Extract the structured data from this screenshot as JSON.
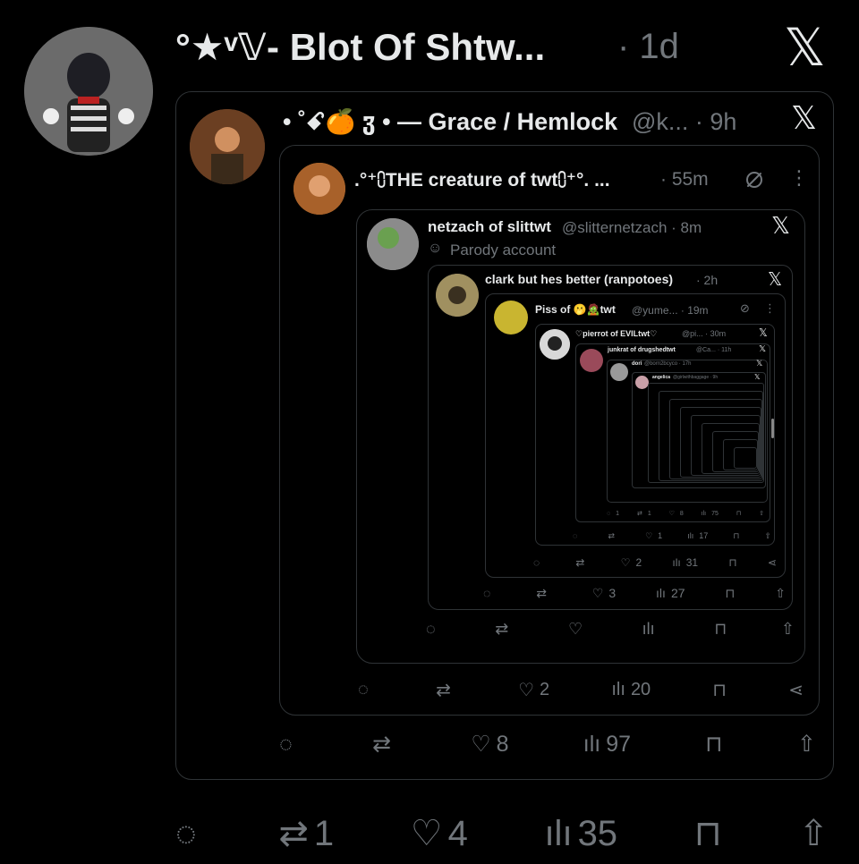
{
  "outer_post": {
    "author": "°★ᵛ𝕍- Blot Of Shtw...",
    "time": "· 1d",
    "actions": {
      "reply": "",
      "repost": "1",
      "like": "4",
      "views": "35"
    }
  },
  "quote1": {
    "author": "• ˚ꗃ🍊 ჳ • — Grace / Hemlock",
    "handle": "@k... · 9h",
    "actions": {
      "reply": "",
      "repost": "",
      "like": "8",
      "views": "97"
    }
  },
  "quote2": {
    "author": ".°⁺⩇THE creature of twt⩇⁺°. ...",
    "time": "· 55m",
    "actions": {
      "reply": "",
      "repost": "",
      "like": "2",
      "views": "20"
    }
  },
  "quote3": {
    "author": "netzach of slittwt",
    "handle": "@slitternetzach · 8m",
    "badge": "Parody account",
    "actions": {
      "reply": "",
      "repost": "",
      "like": "",
      "views": ""
    }
  },
  "quote4": {
    "author": "clark but hes better (ranpotoes)",
    "time": "· 2h",
    "actions": {
      "reply": "",
      "repost": "",
      "like": "3",
      "views": "27"
    }
  },
  "quote5": {
    "author": "Piss of 🫢🧟twt",
    "handle": "@yume... · 19m",
    "actions": {
      "reply": "",
      "repost": "",
      "like": "2",
      "views": "31"
    }
  },
  "quote6": {
    "author": "♡pierrot of EVILtwt♡",
    "handle": "@pi... · 30m",
    "actions": {
      "reply": "",
      "repost": "",
      "like": "1",
      "views": "17"
    }
  },
  "quote7": {
    "author": "junkrat of drugshedtwt",
    "handle": "@Ca... · 11h",
    "actions": {
      "reply": "1",
      "repost": "1",
      "like": "8",
      "views": "75"
    }
  },
  "quote8": {
    "author": "dori",
    "handle": "@born2bcyco · 17h"
  },
  "quote9": {
    "author": "angelica",
    "handle": "@girlwithbaggage · 9h"
  },
  "colors": {
    "background": "#000000",
    "text": "#e7e9ea",
    "muted": "#71767b",
    "border": "#2f3336"
  }
}
